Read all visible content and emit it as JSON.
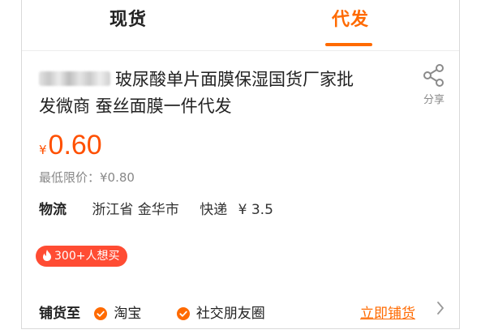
{
  "tabs": [
    {
      "label": "现货",
      "active": false
    },
    {
      "label": "代发",
      "active": true
    }
  ],
  "product": {
    "title_visible": "玻尿酸单片面膜保湿国货厂家批发微商 蚕丝面膜一件代发",
    "title_line1": "玻尿酸单片面膜保湿国货厂家批",
    "title_line2": "发微商 蚕丝面膜一件代发"
  },
  "share": {
    "label": "分享",
    "icon": "share-icon"
  },
  "price": {
    "symbol": "¥",
    "value": "0.60"
  },
  "min_price": "最低限价：¥0.80",
  "logistics": {
    "label": "物流",
    "region": "浙江省 金华市",
    "shipping": "快递",
    "fee": "¥ 3.5"
  },
  "popularity_badge": {
    "text": "300+人想买",
    "icon": "flame-icon"
  },
  "distribution": {
    "label": "铺货至",
    "options": [
      {
        "label": "淘宝",
        "checked": true
      },
      {
        "label": "社交朋友圈",
        "checked": true
      }
    ],
    "cta": "立即铺货"
  },
  "colors": {
    "accent": "#ff6a00",
    "price": "#ff5000",
    "badge": "#ff4c33"
  }
}
